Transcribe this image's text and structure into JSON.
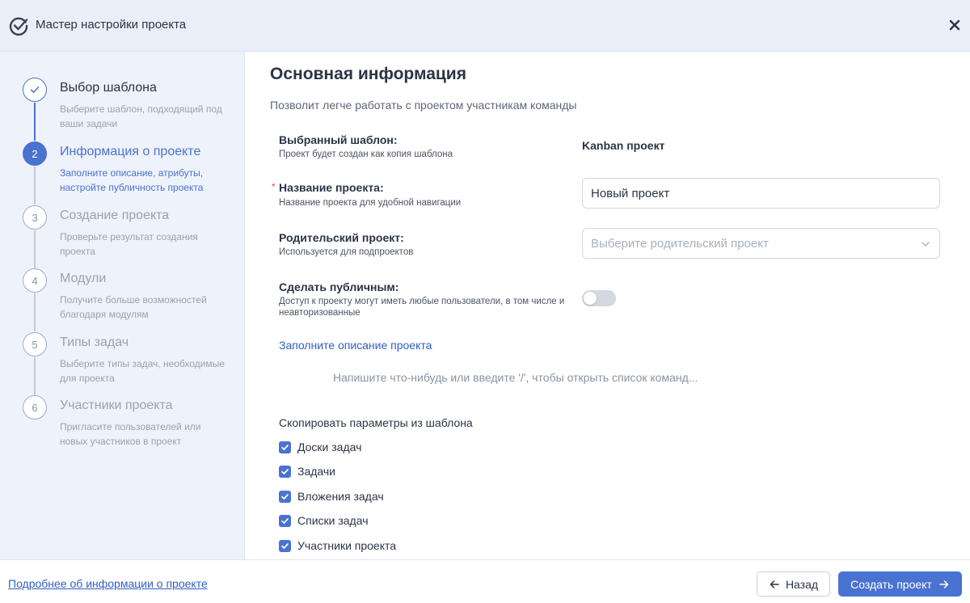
{
  "header": {
    "title": "Мастер настройки проекта",
    "logo_icon": "check-circle-icon",
    "close_icon": "close-icon"
  },
  "sidebar": {
    "steps": [
      {
        "number": "",
        "icon": "check-icon",
        "status": "done",
        "title": "Выбор шаблона",
        "description": "Выберите шаблон, подходящий под ваши задачи"
      },
      {
        "number": "2",
        "status": "active",
        "title": "Информация о проекте",
        "description": "Заполните описание, атрибуты, настройте публичность проекта"
      },
      {
        "number": "3",
        "status": "pending",
        "title": "Создание проекта",
        "description": "Проверьте результат создания проекта"
      },
      {
        "number": "4",
        "status": "pending",
        "title": "Модули",
        "description": "Получите больше возможностей благодаря модулям"
      },
      {
        "number": "5",
        "status": "pending",
        "title": "Типы задач",
        "description": "Выберите типы задач, необходимые для проекта"
      },
      {
        "number": "6",
        "status": "pending",
        "title": "Участники проекта",
        "description": "Пригласите пользователей или новых участников в проект"
      }
    ]
  },
  "main": {
    "title": "Основная информация",
    "subtitle": "Позволит легче работать с проектом участникам команды",
    "template": {
      "label": "Выбранный шаблон:",
      "hint": "Проект будет создан как копия шаблона",
      "value": "Kanban проект"
    },
    "project_name": {
      "required_mark": "*",
      "label": "Название проекта:",
      "hint": "Название проекта для удобной навигации",
      "value": "Новый проект"
    },
    "parent_project": {
      "label": "Родительский проект:",
      "hint": "Используется для подпроектов",
      "placeholder": "Выберите родительский проект"
    },
    "public": {
      "label": "Сделать публичным:",
      "hint": "Доступ к проекту могут иметь любые пользователи, в том числе и неавторизованные",
      "enabled": false
    },
    "description_link": "Заполните описание проекта",
    "editor_placeholder": "Напишите что-нибудь или введите '/', чтобы открыть список команд...",
    "copy_params": {
      "title": "Скопировать параметры из шаблона",
      "items": [
        {
          "label": "Доски задач",
          "checked": true
        },
        {
          "label": "Задачи",
          "checked": true
        },
        {
          "label": "Вложения задач",
          "checked": true
        },
        {
          "label": "Списки задач",
          "checked": true
        },
        {
          "label": "Участники проекта",
          "checked": true
        }
      ]
    }
  },
  "footer": {
    "more_info_link": "Подробнее об информации о проекте",
    "back_label": "Назад",
    "create_label": "Создать проект"
  },
  "colors": {
    "accent": "#4a72d0",
    "header_bg": "#e9eef8",
    "sidebar_bg": "#eef2fa",
    "link": "#2f5fc4",
    "required": "#e5484d"
  }
}
